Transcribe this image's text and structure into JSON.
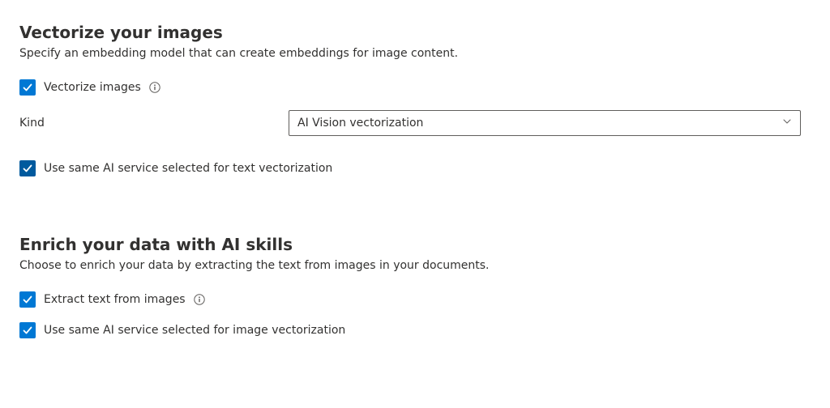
{
  "vectorize": {
    "heading": "Vectorize your images",
    "subtitle": "Specify an embedding model that can create embeddings for image content.",
    "checkbox_label": "Vectorize images",
    "kind_label": "Kind",
    "kind_value": "AI Vision vectorization",
    "use_same_label": "Use same AI service selected for text vectorization"
  },
  "enrich": {
    "heading": "Enrich your data with AI skills",
    "subtitle": "Choose to enrich your data by extracting the text from images in your documents.",
    "extract_label": "Extract text from images",
    "use_same_label": "Use same AI service selected for image vectorization"
  }
}
